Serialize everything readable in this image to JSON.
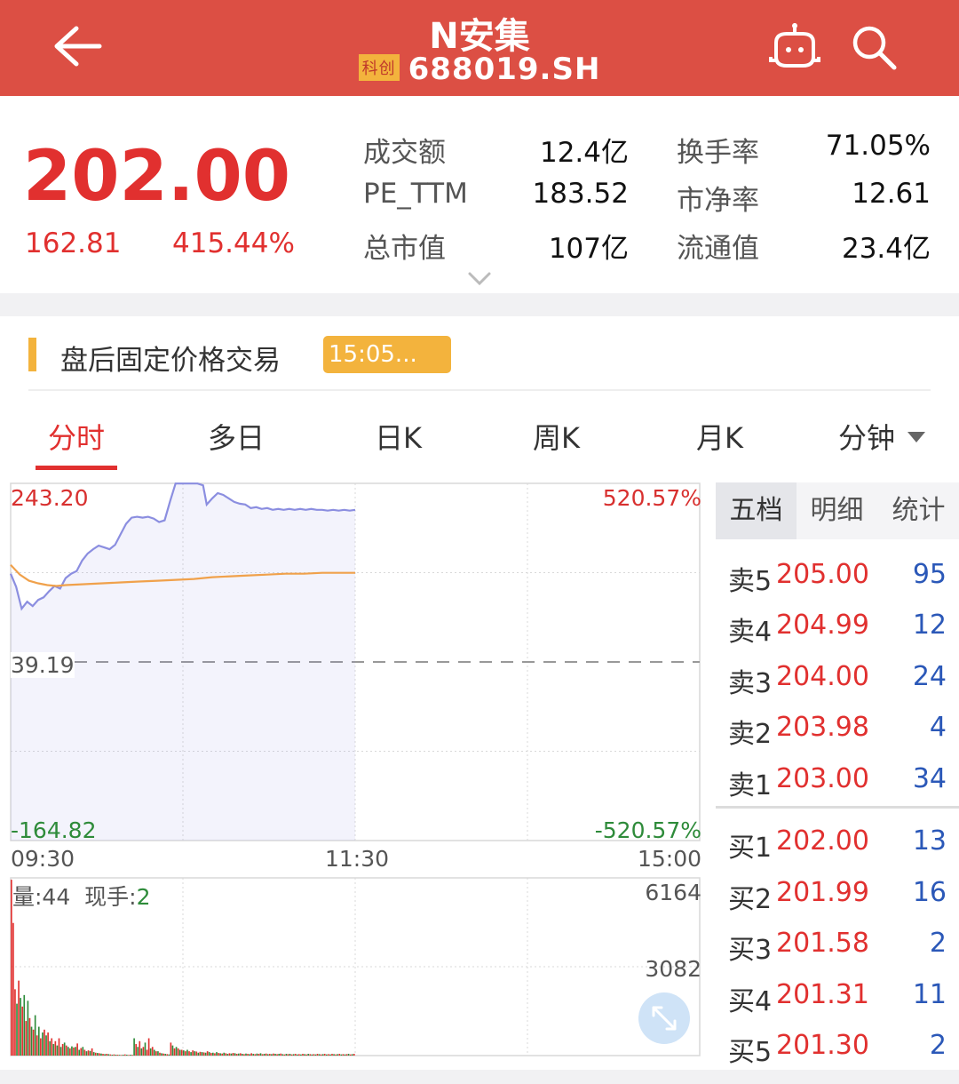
{
  "header": {
    "title": "N安集",
    "badge": "科创",
    "code": "688019.SH"
  },
  "quote": {
    "price": "202.00",
    "change": "162.81",
    "change_pct": "415.44%",
    "stats": [
      {
        "label": "成交额",
        "value": "12.4亿"
      },
      {
        "label": "换手率",
        "value": "71.05%"
      },
      {
        "label": "PE_TTM",
        "value": "183.52"
      },
      {
        "label": "市净率",
        "value": "12.61"
      },
      {
        "label": "总市值",
        "value": "107亿"
      },
      {
        "label": "流通值",
        "value": "23.4亿"
      }
    ]
  },
  "post_market": {
    "label": "盘后固定价格交易",
    "time": "15:05..."
  },
  "tabs": [
    "分时",
    "多日",
    "日K",
    "周K",
    "月K",
    "分钟"
  ],
  "chart": {
    "y_high": "243.20",
    "y_high_pct": "520.57%",
    "y_mid": "39.19",
    "y_low": "-164.82",
    "y_low_pct": "-520.57%",
    "x_labels": [
      "09:30",
      "11:30",
      "15:00"
    ],
    "volume_label": "量:44",
    "current_hand_label": "现手:",
    "current_hand_value": "2",
    "vol_max": "6164",
    "vol_mid": "3082"
  },
  "chart_data": {
    "type": "line",
    "x_axis": [
      "09:30",
      "11:30",
      "15:00"
    ],
    "ylim": [
      -164.82,
      243.2
    ],
    "reference": 39.19,
    "price_series": [
      [
        0,
        140
      ],
      [
        3,
        125
      ],
      [
        6,
        100
      ],
      [
        9,
        108
      ],
      [
        12,
        103
      ],
      [
        15,
        110
      ],
      [
        18,
        113
      ],
      [
        21,
        120
      ],
      [
        24,
        126
      ],
      [
        27,
        123
      ],
      [
        30,
        135
      ],
      [
        33,
        140
      ],
      [
        36,
        143
      ],
      [
        39,
        155
      ],
      [
        42,
        163
      ],
      [
        45,
        168
      ],
      [
        48,
        172
      ],
      [
        51,
        170
      ],
      [
        54,
        168
      ],
      [
        57,
        173
      ],
      [
        60,
        185
      ],
      [
        63,
        197
      ],
      [
        66,
        204
      ],
      [
        69,
        205
      ],
      [
        72,
        204
      ],
      [
        75,
        205
      ],
      [
        78,
        203
      ],
      [
        81,
        199
      ],
      [
        84,
        201
      ],
      [
        87,
        223
      ],
      [
        90,
        243
      ],
      [
        93,
        243
      ],
      [
        96,
        243
      ],
      [
        99,
        243
      ],
      [
        102,
        243
      ],
      [
        105,
        241
      ],
      [
        107,
        219
      ],
      [
        110,
        226
      ],
      [
        113,
        232
      ],
      [
        116,
        230
      ],
      [
        119,
        226
      ],
      [
        122,
        222
      ],
      [
        125,
        220
      ],
      [
        128,
        219
      ],
      [
        131,
        215
      ],
      [
        134,
        216
      ],
      [
        137,
        214
      ],
      [
        140,
        215
      ],
      [
        143,
        213
      ],
      [
        146,
        214
      ],
      [
        149,
        213
      ],
      [
        152,
        214
      ],
      [
        155,
        213
      ],
      [
        158,
        214
      ],
      [
        161,
        213
      ],
      [
        164,
        214
      ],
      [
        167,
        213
      ],
      [
        170,
        213
      ],
      [
        173,
        212
      ],
      [
        176,
        213
      ],
      [
        179,
        212
      ],
      [
        182,
        213
      ],
      [
        185,
        212
      ],
      [
        188,
        213
      ]
    ],
    "avg_series": [
      [
        0,
        150
      ],
      [
        5,
        139
      ],
      [
        10,
        132
      ],
      [
        15,
        129
      ],
      [
        20,
        127
      ],
      [
        25,
        126
      ],
      [
        30,
        127
      ],
      [
        40,
        128
      ],
      [
        50,
        129
      ],
      [
        60,
        130
      ],
      [
        70,
        131
      ],
      [
        80,
        132
      ],
      [
        90,
        133
      ],
      [
        100,
        134
      ],
      [
        110,
        136
      ],
      [
        120,
        137
      ],
      [
        130,
        138
      ],
      [
        140,
        139
      ],
      [
        150,
        140
      ],
      [
        160,
        140
      ],
      [
        170,
        141
      ],
      [
        180,
        141
      ],
      [
        188,
        141
      ]
    ],
    "x_total_minutes": 376,
    "volume_ylim": [
      0,
      6164
    ],
    "volume_series": [
      [
        0,
        6100,
        "r"
      ],
      [
        1,
        4600,
        "r"
      ],
      [
        2,
        2300,
        "r"
      ],
      [
        3,
        1800,
        "g"
      ],
      [
        4,
        2600,
        "r"
      ],
      [
        5,
        2000,
        "g"
      ],
      [
        6,
        1700,
        "r"
      ],
      [
        7,
        2100,
        "g"
      ],
      [
        8,
        1200,
        "r"
      ],
      [
        9,
        1900,
        "g"
      ],
      [
        10,
        1300,
        "r"
      ],
      [
        11,
        1000,
        "g"
      ],
      [
        12,
        900,
        "r"
      ],
      [
        13,
        1400,
        "g"
      ],
      [
        14,
        700,
        "r"
      ],
      [
        15,
        1000,
        "g"
      ],
      [
        16,
        600,
        "r"
      ],
      [
        17,
        800,
        "g"
      ],
      [
        18,
        900,
        "r"
      ],
      [
        19,
        700,
        "g"
      ],
      [
        20,
        800,
        "r"
      ],
      [
        21,
        500,
        "g"
      ],
      [
        22,
        600,
        "r"
      ],
      [
        23,
        400,
        "g"
      ],
      [
        24,
        500,
        "r"
      ],
      [
        25,
        350,
        "g"
      ],
      [
        26,
        600,
        "r"
      ],
      [
        27,
        300,
        "g"
      ],
      [
        28,
        400,
        "r"
      ],
      [
        29,
        450,
        "g"
      ],
      [
        30,
        350,
        "r"
      ],
      [
        31,
        300,
        "g"
      ],
      [
        32,
        250,
        "r"
      ],
      [
        33,
        320,
        "g"
      ],
      [
        34,
        280,
        "r"
      ],
      [
        35,
        300,
        "g"
      ],
      [
        36,
        420,
        "r"
      ],
      [
        37,
        200,
        "g"
      ],
      [
        38,
        260,
        "r"
      ],
      [
        39,
        300,
        "g"
      ],
      [
        40,
        200,
        "r"
      ],
      [
        41,
        150,
        "g"
      ],
      [
        42,
        180,
        "r"
      ],
      [
        43,
        160,
        "g"
      ],
      [
        44,
        250,
        "r"
      ],
      [
        45,
        120,
        "g"
      ],
      [
        46,
        100,
        "r"
      ],
      [
        47,
        90,
        "g"
      ],
      [
        48,
        80,
        "r"
      ],
      [
        49,
        70,
        "g"
      ],
      [
        50,
        60,
        "r"
      ],
      [
        51,
        50,
        "g"
      ],
      [
        52,
        60,
        "r"
      ],
      [
        53,
        50,
        "g"
      ],
      [
        54,
        40,
        "r"
      ],
      [
        55,
        30,
        "g"
      ],
      [
        56,
        40,
        "r"
      ],
      [
        57,
        30,
        "g"
      ],
      [
        58,
        30,
        "r"
      ],
      [
        59,
        25,
        "g"
      ],
      [
        60,
        20,
        "r"
      ],
      [
        61,
        30,
        "g"
      ],
      [
        62,
        40,
        "r"
      ],
      [
        63,
        30,
        "g"
      ],
      [
        64,
        20,
        "r"
      ],
      [
        65,
        30,
        "g"
      ],
      [
        66,
        25,
        "r"
      ],
      [
        67,
        600,
        "g"
      ],
      [
        68,
        400,
        "r"
      ],
      [
        69,
        300,
        "g"
      ],
      [
        70,
        500,
        "r"
      ],
      [
        71,
        250,
        "g"
      ],
      [
        72,
        300,
        "r"
      ],
      [
        73,
        450,
        "g"
      ],
      [
        74,
        200,
        "r"
      ],
      [
        75,
        600,
        "r"
      ],
      [
        76,
        250,
        "g"
      ],
      [
        77,
        300,
        "r"
      ],
      [
        78,
        200,
        "g"
      ],
      [
        79,
        150,
        "r"
      ],
      [
        80,
        150,
        "g"
      ],
      [
        81,
        100,
        "r"
      ],
      [
        82,
        80,
        "g"
      ],
      [
        83,
        70,
        "r"
      ],
      [
        84,
        60,
        "g"
      ],
      [
        85,
        50,
        "r"
      ],
      [
        86,
        40,
        "g"
      ],
      [
        87,
        450,
        "r"
      ],
      [
        88,
        350,
        "g"
      ],
      [
        89,
        250,
        "r"
      ],
      [
        90,
        300,
        "g"
      ],
      [
        91,
        250,
        "r"
      ],
      [
        92,
        200,
        "g"
      ],
      [
        93,
        200,
        "r"
      ],
      [
        94,
        180,
        "g"
      ],
      [
        95,
        150,
        "r"
      ],
      [
        96,
        200,
        "g"
      ],
      [
        97,
        150,
        "r"
      ],
      [
        98,
        120,
        "g"
      ],
      [
        99,
        180,
        "r"
      ],
      [
        100,
        150,
        "g"
      ],
      [
        101,
        140,
        "r"
      ],
      [
        102,
        100,
        "g"
      ],
      [
        103,
        130,
        "r"
      ],
      [
        104,
        120,
        "g"
      ],
      [
        105,
        110,
        "r"
      ],
      [
        106,
        100,
        "g"
      ],
      [
        107,
        150,
        "r"
      ],
      [
        108,
        120,
        "g"
      ],
      [
        109,
        90,
        "r"
      ],
      [
        110,
        100,
        "g"
      ],
      [
        111,
        80,
        "r"
      ],
      [
        112,
        120,
        "g"
      ],
      [
        113,
        90,
        "r"
      ],
      [
        114,
        80,
        "g"
      ],
      [
        115,
        70,
        "r"
      ],
      [
        116,
        100,
        "g"
      ],
      [
        117,
        80,
        "r"
      ],
      [
        118,
        60,
        "g"
      ],
      [
        119,
        80,
        "r"
      ],
      [
        120,
        70,
        "g"
      ],
      [
        121,
        90,
        "r"
      ],
      [
        122,
        80,
        "g"
      ],
      [
        123,
        60,
        "r"
      ],
      [
        124,
        70,
        "g"
      ],
      [
        125,
        80,
        "r"
      ],
      [
        126,
        60,
        "g"
      ],
      [
        127,
        50,
        "r"
      ],
      [
        128,
        70,
        "g"
      ],
      [
        129,
        60,
        "r"
      ],
      [
        130,
        50,
        "g"
      ],
      [
        131,
        80,
        "r"
      ],
      [
        132,
        60,
        "g"
      ],
      [
        133,
        50,
        "r"
      ],
      [
        134,
        70,
        "g"
      ],
      [
        135,
        60,
        "r"
      ],
      [
        136,
        80,
        "g"
      ],
      [
        137,
        50,
        "r"
      ],
      [
        138,
        60,
        "g"
      ],
      [
        139,
        70,
        "r"
      ],
      [
        140,
        50,
        "g"
      ],
      [
        141,
        60,
        "r"
      ],
      [
        142,
        50,
        "g"
      ],
      [
        143,
        70,
        "r"
      ],
      [
        144,
        60,
        "g"
      ],
      [
        145,
        50,
        "r"
      ],
      [
        146,
        60,
        "g"
      ],
      [
        147,
        70,
        "r"
      ],
      [
        148,
        50,
        "g"
      ],
      [
        149,
        40,
        "r"
      ],
      [
        150,
        60,
        "g"
      ],
      [
        151,
        50,
        "r"
      ],
      [
        152,
        60,
        "g"
      ],
      [
        153,
        40,
        "r"
      ],
      [
        154,
        50,
        "g"
      ],
      [
        155,
        60,
        "r"
      ],
      [
        156,
        40,
        "g"
      ],
      [
        157,
        50,
        "r"
      ],
      [
        158,
        40,
        "g"
      ],
      [
        159,
        60,
        "r"
      ],
      [
        160,
        50,
        "g"
      ],
      [
        161,
        40,
        "r"
      ],
      [
        162,
        60,
        "g"
      ],
      [
        163,
        50,
        "r"
      ],
      [
        164,
        40,
        "g"
      ],
      [
        165,
        50,
        "r"
      ],
      [
        166,
        40,
        "g"
      ],
      [
        167,
        60,
        "r"
      ],
      [
        168,
        50,
        "g"
      ],
      [
        169,
        40,
        "r"
      ],
      [
        170,
        50,
        "g"
      ],
      [
        171,
        60,
        "r"
      ],
      [
        172,
        40,
        "g"
      ],
      [
        173,
        50,
        "r"
      ],
      [
        174,
        40,
        "g"
      ],
      [
        175,
        60,
        "r"
      ],
      [
        176,
        50,
        "g"
      ],
      [
        177,
        40,
        "r"
      ],
      [
        178,
        50,
        "g"
      ],
      [
        179,
        60,
        "r"
      ],
      [
        180,
        40,
        "g"
      ],
      [
        181,
        50,
        "r"
      ],
      [
        182,
        40,
        "g"
      ],
      [
        183,
        50,
        "r"
      ],
      [
        184,
        60,
        "g"
      ],
      [
        185,
        40,
        "r"
      ],
      [
        186,
        50,
        "g"
      ],
      [
        187,
        60,
        "r"
      ]
    ]
  },
  "order_book": {
    "tabs": [
      "五档",
      "明细",
      "统计"
    ],
    "asks": [
      {
        "name": "卖5",
        "price": "205.00",
        "vol": "95"
      },
      {
        "name": "卖4",
        "price": "204.99",
        "vol": "12"
      },
      {
        "name": "卖3",
        "price": "204.00",
        "vol": "24"
      },
      {
        "name": "卖2",
        "price": "203.98",
        "vol": "4"
      },
      {
        "name": "卖1",
        "price": "203.00",
        "vol": "34"
      }
    ],
    "bids": [
      {
        "name": "买1",
        "price": "202.00",
        "vol": "13"
      },
      {
        "name": "买2",
        "price": "201.99",
        "vol": "16"
      },
      {
        "name": "买3",
        "price": "201.58",
        "vol": "2"
      },
      {
        "name": "买4",
        "price": "201.31",
        "vol": "11"
      },
      {
        "name": "买5",
        "price": "201.30",
        "vol": "2"
      }
    ]
  },
  "colors": {
    "header_bg": "#dc4f44",
    "up_red": "#e1302f",
    "down_green": "#2e8b3a",
    "price_line": "#8b8ee0",
    "avg_line": "#f0a14b",
    "badge": "#f3b33d",
    "ob_volume": "#2b58b8"
  }
}
